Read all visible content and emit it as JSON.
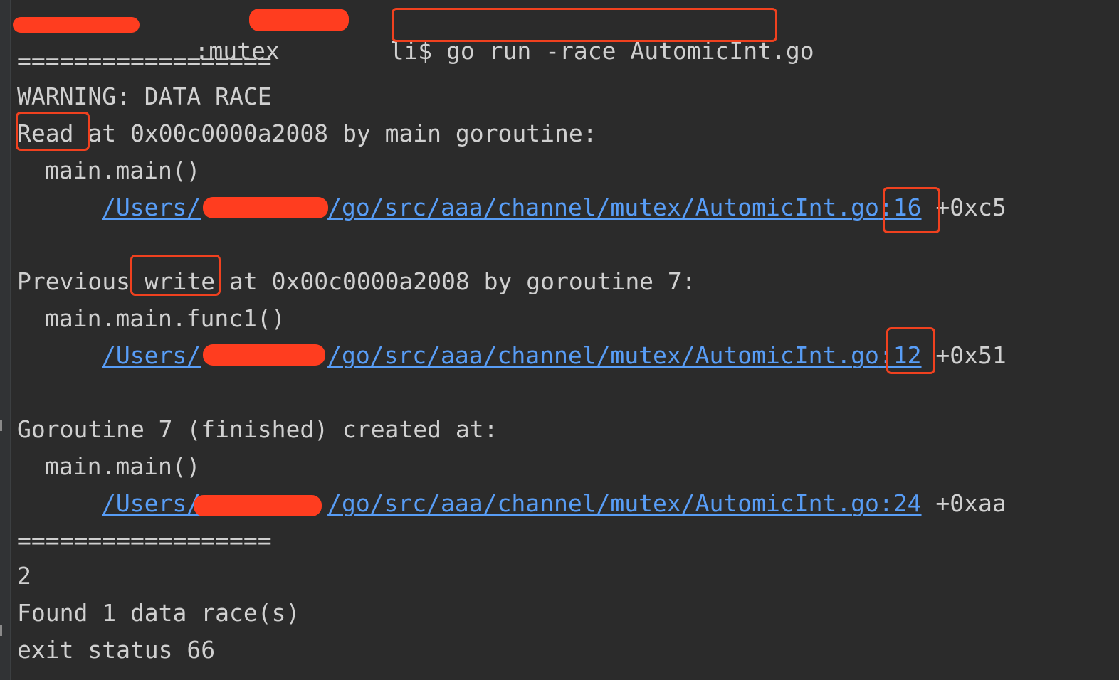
{
  "prompt": {
    "host_suffix": ":mutex ",
    "prompt_suffix": "li$ ",
    "command": "go run -race AutomicInt.go"
  },
  "output": {
    "separator": "==================",
    "warning": "WARNING: DATA RACE",
    "read_keyword": "Read",
    "read_rest": " at 0x00c0000a2008 by main goroutine:",
    "read_func": "main.main()",
    "read_path_prefix": "/Users/",
    "read_path_rest": "/go/src/aaa/channel/mutex/AutomicInt.go",
    "read_line": ":16",
    "read_offset": " +0xc5",
    "prev_prefix": "Previous ",
    "write_keyword": "write",
    "prev_rest": " at 0x00c0000a2008 by goroutine 7:",
    "write_func": "main.main.func1()",
    "write_path_prefix": "/Users/",
    "write_path_rest": "/go/src/aaa/channel/mutex/AutomicInt.go",
    "write_line": ":12",
    "write_offset": " +0x51",
    "created": "Goroutine 7 (finished) created at:",
    "created_func": "main.main()",
    "created_path_prefix": "/Users/",
    "created_path_rest": "/go/src/aaa/channel/mutex/AutomicInt.go:24",
    "created_offset": " +0xaa",
    "separator2": "==================",
    "result": "2",
    "found": "Found 1 data race(s)",
    "exit": "exit status 66"
  },
  "colors": {
    "background": "#2b2b2b",
    "text": "#d0d0d0",
    "link": "#589df6",
    "annotation": "#f0411f",
    "redaction": "#ff3d1f"
  }
}
